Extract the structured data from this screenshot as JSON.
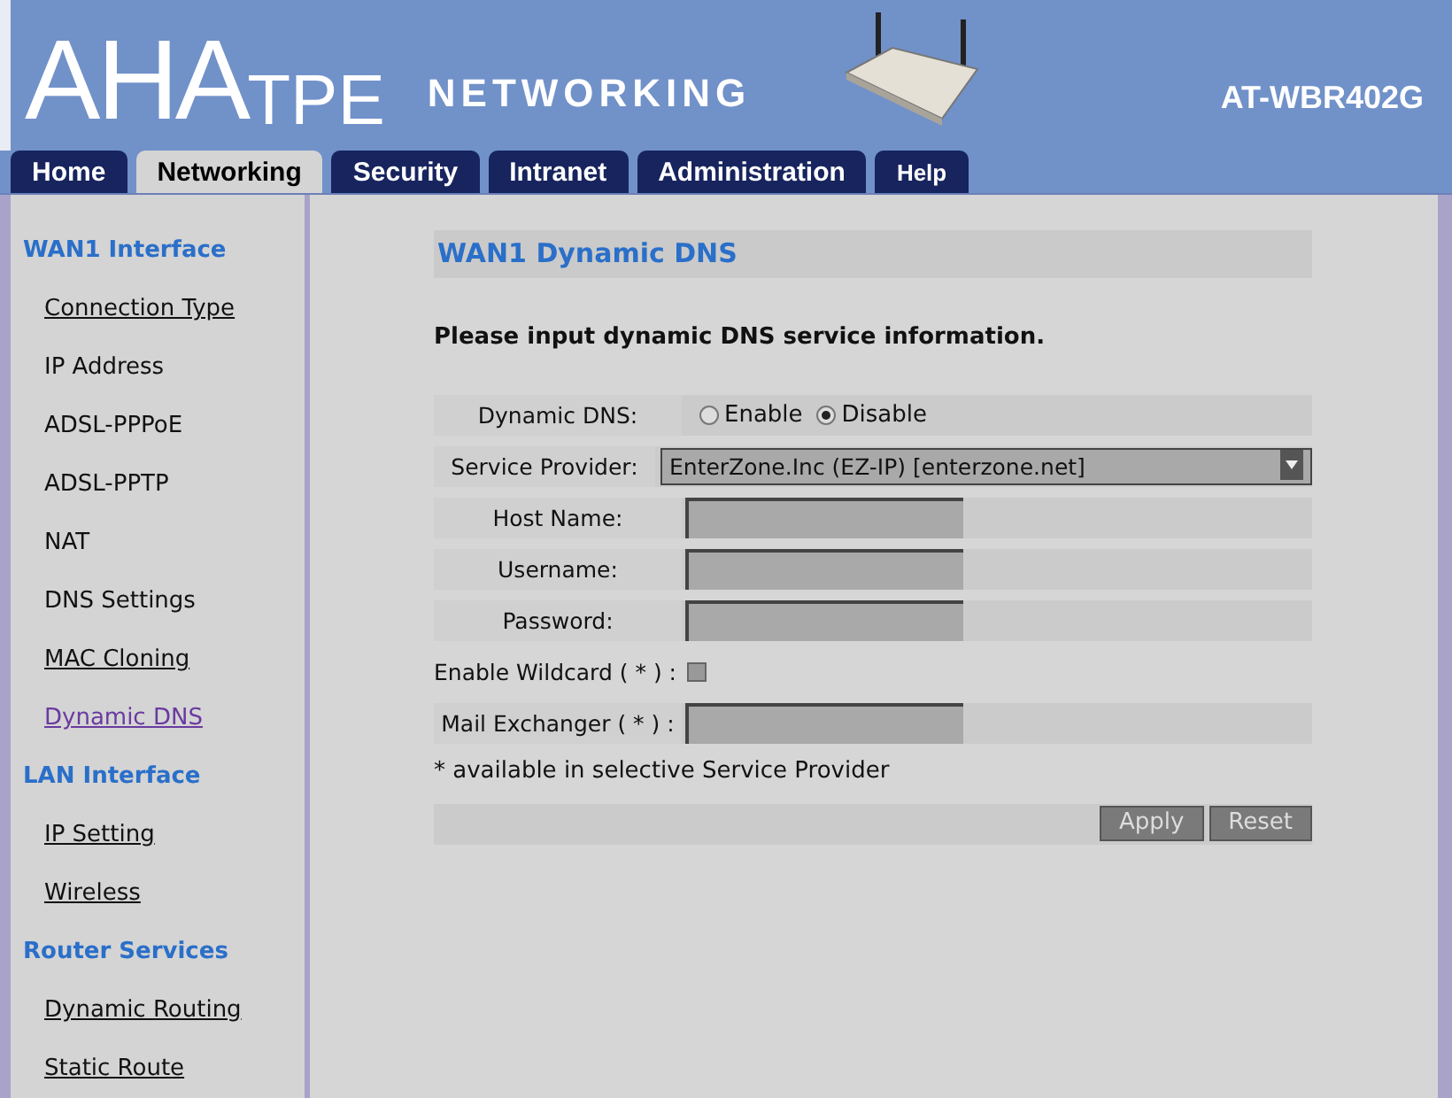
{
  "header": {
    "logo_main": "AHA",
    "logo_suffix": "TPE",
    "tagline": "NETWORKING",
    "model": "AT-WBR402G"
  },
  "tabs": [
    {
      "label": "Home",
      "selected": false
    },
    {
      "label": "Networking",
      "selected": true
    },
    {
      "label": "Security",
      "selected": false
    },
    {
      "label": "Intranet",
      "selected": false
    },
    {
      "label": "Administration",
      "selected": false
    },
    {
      "label": "Help",
      "selected": false
    }
  ],
  "sidebar": [
    {
      "title": "WAN1 Interface",
      "children": [
        {
          "label": "Connection Type",
          "link": true,
          "selected": false
        },
        {
          "label": "IP Address",
          "link": false,
          "selected": false
        },
        {
          "label": "ADSL-PPPoE",
          "link": false,
          "selected": false
        },
        {
          "label": "ADSL-PPTP",
          "link": false,
          "selected": false
        },
        {
          "label": "NAT",
          "link": false,
          "selected": false
        },
        {
          "label": "DNS Settings",
          "link": false,
          "selected": false
        },
        {
          "label": "MAC Cloning",
          "link": true,
          "selected": false
        },
        {
          "label": "Dynamic DNS",
          "link": true,
          "selected": true
        }
      ]
    },
    {
      "title": "LAN Interface",
      "children": [
        {
          "label": "IP Setting",
          "link": true,
          "selected": false
        },
        {
          "label": "Wireless",
          "link": true,
          "selected": false
        }
      ]
    },
    {
      "title": "Router Services",
      "children": [
        {
          "label": "Dynamic Routing",
          "link": true,
          "selected": false
        },
        {
          "label": "Static Route",
          "link": true,
          "selected": false
        }
      ]
    }
  ],
  "content": {
    "title": "WAN1 Dynamic DNS",
    "intro": "Please input dynamic DNS service information.",
    "rows": [
      {
        "kind": "radio",
        "label": "Dynamic DNS:",
        "options": [
          {
            "label": "Enable",
            "selected": false
          },
          {
            "label": "Disable",
            "selected": true
          }
        ]
      },
      {
        "kind": "select",
        "label": "Service Provider:",
        "value": "EnterZone.Inc (EZ-IP) [enterzone.net]"
      },
      {
        "kind": "text",
        "label": "Host Name:"
      },
      {
        "kind": "text",
        "label": "Username:"
      },
      {
        "kind": "text",
        "label": "Password:"
      },
      {
        "kind": "checkbox",
        "label": "Enable Wildcard ( * ) :",
        "checked": false
      },
      {
        "kind": "text",
        "label": "Mail Exchanger ( * ) :"
      }
    ],
    "note": "* available in selective Service Provider",
    "buttons": [
      "Apply",
      "Reset"
    ]
  }
}
